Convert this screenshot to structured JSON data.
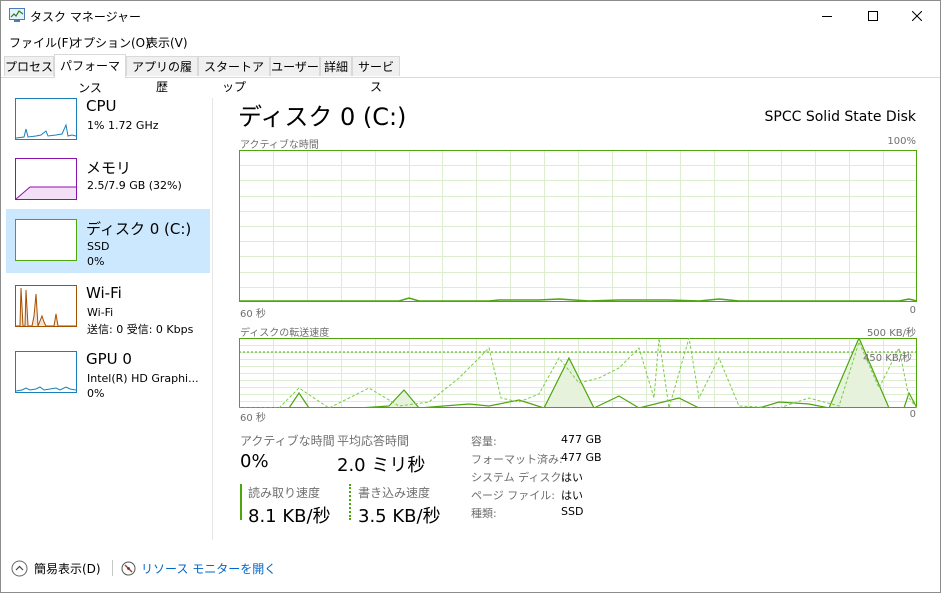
{
  "window": {
    "title": "タスク マネージャー"
  },
  "menu": [
    "ファイル(F)",
    "オプション(O)",
    "表示(V)"
  ],
  "tabs": [
    "プロセス",
    "パフォーマンス",
    "アプリの履歴",
    "スタートアップ",
    "ユーザー",
    "詳細",
    "サービス"
  ],
  "active_tab": "パフォーマンス",
  "sidebar": [
    {
      "title": "CPU",
      "line2": "1%  1.72 GHz",
      "line3": "",
      "color": "#1b7fba"
    },
    {
      "title": "メモリ",
      "line2": "2.5/7.9 GB (32%)",
      "line3": "",
      "color": "#8b12ae"
    },
    {
      "title": "ディスク 0 (C:)",
      "line2": "SSD",
      "line3": "0%",
      "color": "#4da60c"
    },
    {
      "title": "Wi-Fi",
      "line2": "Wi-Fi",
      "line3": "送信: 0 受信: 0 Kbps",
      "color": "#a74f01"
    },
    {
      "title": "GPU 0",
      "line2": "Intel(R) HD Graphi...",
      "line3": "0%",
      "color": "#1b7fba"
    }
  ],
  "main": {
    "title": "ディスク 0 (C:)",
    "model": "SPCC Solid State Disk",
    "graph1": {
      "label": "アクティブな時間",
      "max": "100%",
      "time": "60 秒",
      "min": "0"
    },
    "graph2": {
      "label": "ディスクの転送速度",
      "max": "500 KB/秒",
      "ref": "450 KB/秒",
      "time": "60 秒",
      "min": "0"
    },
    "stats": {
      "active_label": "アクティブな時間",
      "active_value": "0%",
      "response_label": "平均応答時間",
      "response_value": "2.0 ミリ秒",
      "read_label": "読み取り速度",
      "read_value": "8.1 KB/秒",
      "write_label": "書き込み速度",
      "write_value": "3.5 KB/秒"
    },
    "info": [
      {
        "label": "容量:",
        "value": "477 GB"
      },
      {
        "label": "フォーマット済み:",
        "value": "477 GB"
      },
      {
        "label": "システム ディスク:",
        "value": "はい"
      },
      {
        "label": "ページ ファイル:",
        "value": "はい"
      },
      {
        "label": "種類:",
        "value": "SSD"
      }
    ]
  },
  "footer": {
    "simple_view": "簡易表示(D)",
    "resource_monitor": "リソース モニターを開く"
  },
  "colors": {
    "disk": "#4da60c",
    "grid": "#dcedd0",
    "selected": "#cce8ff",
    "link": "#0066cc"
  }
}
